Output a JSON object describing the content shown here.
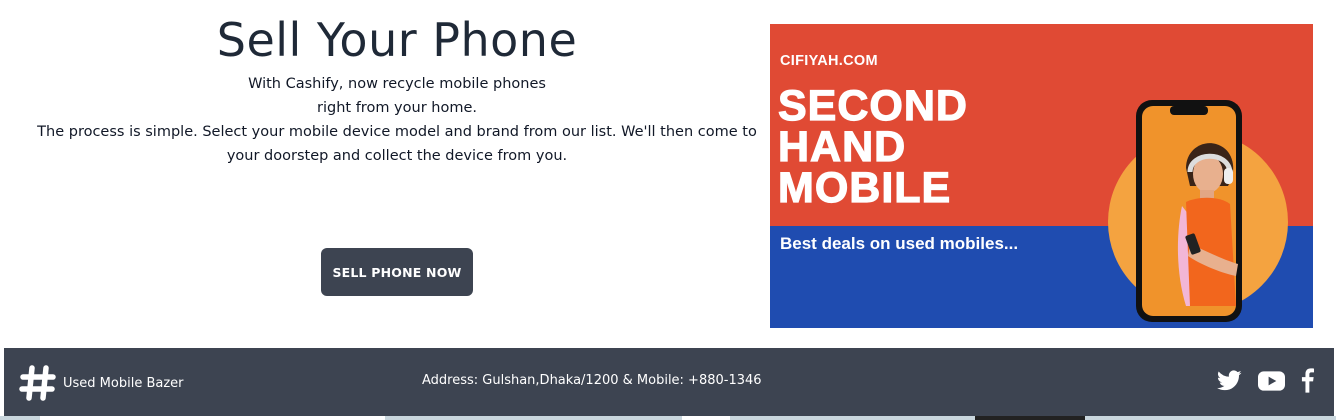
{
  "hero": {
    "title": "Sell Your Phone",
    "desc_line1": "With Cashify, now recycle mobile phones",
    "desc_line2": "right from your home.",
    "desc_line3": "The process is simple. Select your mobile device model and brand from our list. We'll then come to your doorstep and collect the device from you.",
    "button_label": "SELL PHONE NOW"
  },
  "banner": {
    "site": "CIFIYAH.COM",
    "headline_1": "SECOND",
    "headline_2": "HAND",
    "headline_3": "MOBILE",
    "tagline": "Best deals on used mobiles...",
    "colors": {
      "top": "#e04a34",
      "bottom": "#1f4cb0",
      "circle": "#f4a340"
    }
  },
  "footer": {
    "brand_name": "Used Mobile Bazer",
    "address": "Address: Gulshan,Dhaka/1200 & Mobile: +880-1346",
    "social_icons": [
      "twitter-icon",
      "youtube-icon",
      "facebook-icon"
    ],
    "background": "#3d4451"
  }
}
